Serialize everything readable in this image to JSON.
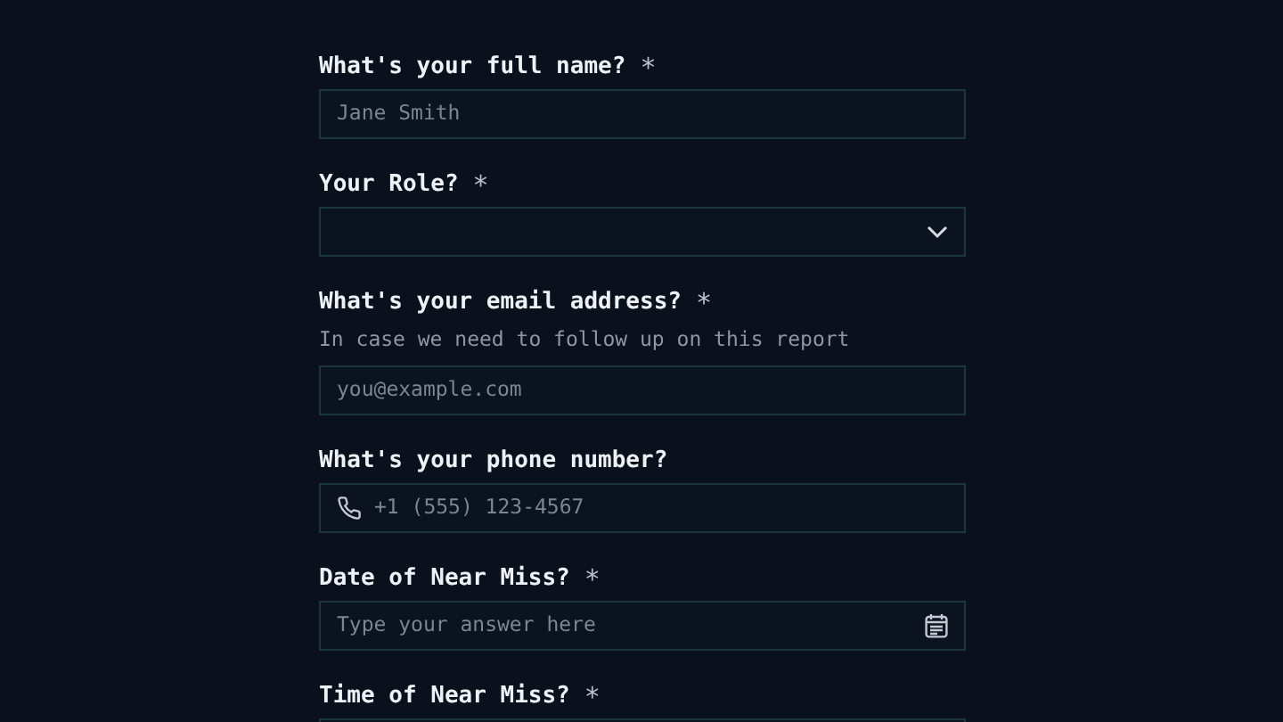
{
  "fields": [
    {
      "kind": "text",
      "label": "What's your full name?",
      "required_mark": "*",
      "placeholder": "Jane Smith"
    },
    {
      "kind": "select",
      "label": "Your Role?",
      "required_mark": "*"
    },
    {
      "kind": "email",
      "label": "What's your email address?",
      "required_mark": "*",
      "hint": "In case we need to follow up on this report",
      "placeholder": "you@example.com"
    },
    {
      "kind": "phone",
      "label": "What's your phone number?",
      "placeholder": "+1 (555) 123-4567"
    },
    {
      "kind": "date",
      "label": "Date of Near Miss?",
      "required_mark": "*",
      "placeholder": "Type your answer here"
    },
    {
      "kind": "time",
      "label": "Time of Near Miss?",
      "required_mark": "*"
    }
  ]
}
